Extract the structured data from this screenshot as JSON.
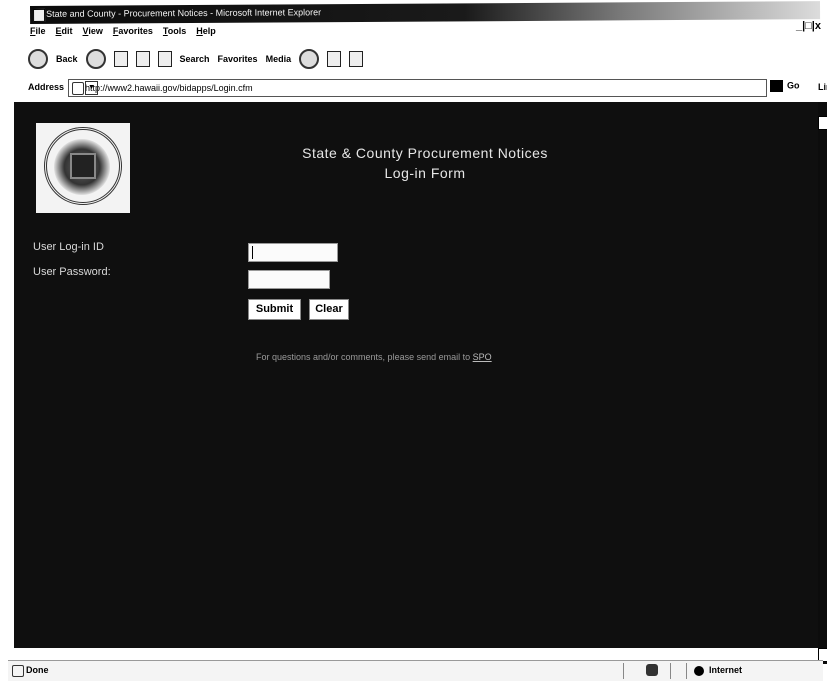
{
  "window": {
    "title": "State and County - Procurement Notices - Microsoft Internet Explorer",
    "controls": "_|□|x"
  },
  "menu": [
    "File",
    "Edit",
    "View",
    "Favorites",
    "Tools",
    "Help"
  ],
  "toolbar": {
    "back_label": "Back",
    "search_label": "Search",
    "favorites_label": "Favorites",
    "media_label": "Media"
  },
  "address": {
    "label": "Address",
    "url": "http://www2.hawaii.gov/bidapps/Login.cfm",
    "go_label": "Go",
    "links_label": "Links"
  },
  "page": {
    "heading_line1": "State & County Procurement Notices",
    "heading_line2": "Log-in Form",
    "user_label": "User Log-in ID",
    "password_label": "User Password:",
    "user_value": "",
    "password_value": "",
    "submit_label": "Submit",
    "clear_label": "Clear",
    "contact_text": "For questions and/or comments, please send email to",
    "contact_link": "SPO"
  },
  "status": {
    "text": "Done",
    "zone": "Internet"
  }
}
